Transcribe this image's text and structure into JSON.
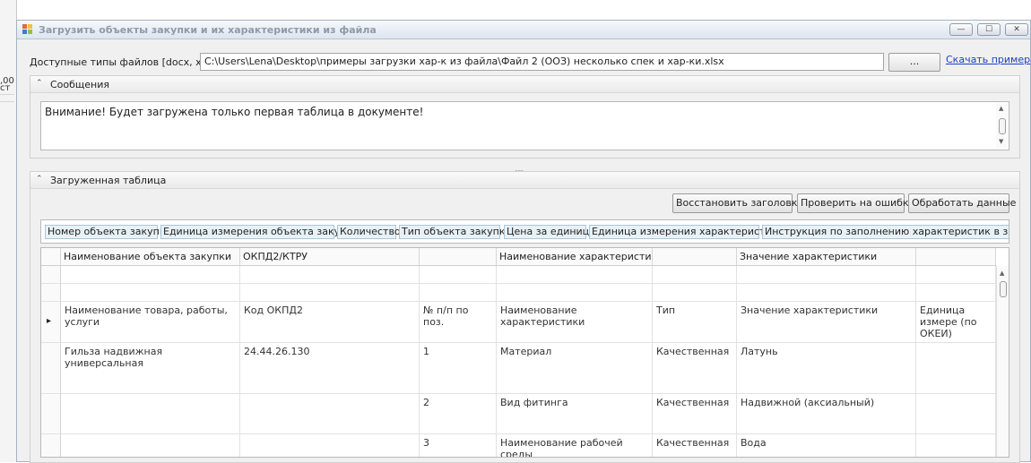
{
  "background": {
    "cells": [
      ",00",
      "ст"
    ]
  },
  "window": {
    "title": "Загрузить объекты закупки и их характеристики из файла",
    "buttons": {
      "minimize": "—",
      "maximize": "☐",
      "close": "✕"
    }
  },
  "file": {
    "label": "Доступные типы файлов [docx, xlsx]",
    "path": "C:\\Users\\Lena\\Desktop\\примеры загрузки хар-к из файла\\Файл 2 (ООЗ) несколько спек и хар-ки.xlsx",
    "browse_label": "...",
    "download_link": "Скачать пример"
  },
  "messages": {
    "title": "Сообщения",
    "text": "Внимание! Будет загружена только первая таблица в документе!"
  },
  "splitter_grip": "......",
  "loaded": {
    "title": "Загруженная таблица",
    "buttons": [
      "Восстановить заголовки",
      "Проверить на ошибки",
      "Обработать данные"
    ],
    "header_tags": [
      "Номер объекта закупки",
      "Единица измерения объекта закупки",
      "Количество",
      "Тип объекта закупки",
      "Цена за единицу",
      "Единица измерения характеристики",
      "Инструкция по заполнению характеристик в заявке"
    ],
    "columns": [
      "Наименование объекта закупки",
      "ОКПД2/КТРУ",
      "",
      "Наименование характеристики",
      "",
      "Значение характеристики",
      ""
    ],
    "current_row_marker": "▸",
    "rows": [
      [
        "",
        "",
        "",
        "",
        "",
        "",
        ""
      ],
      [
        "",
        "",
        "",
        "",
        "",
        "",
        ""
      ],
      [
        "Наименование товара, работы, услуги",
        "Код ОКПД2",
        "№ п/п по поз.",
        "Наименование характеристики",
        "Тип",
        "Значение характеристики",
        "Единица измере (по ОКЕИ)"
      ],
      [
        "Гильза надвижная универсальная",
        "24.44.26.130",
        "1",
        "Материал",
        "Качественная",
        "Латунь",
        ""
      ],
      [
        "",
        "",
        "2",
        "Вид фитинга",
        "Качественная",
        "Надвижной (аксиальный)",
        ""
      ],
      [
        "",
        "",
        "3",
        "Наименование рабочей среды",
        "Качественная",
        "Вода",
        ""
      ]
    ]
  }
}
